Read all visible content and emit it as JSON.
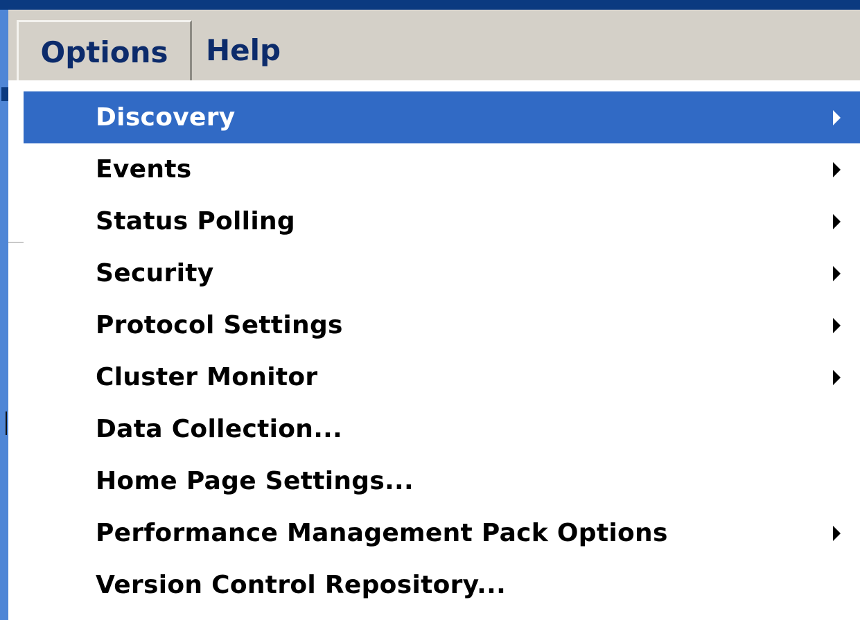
{
  "menubar": {
    "items": [
      {
        "label": "Options"
      },
      {
        "label": "Help"
      }
    ]
  },
  "dropdown": {
    "items": [
      {
        "label": "Discovery",
        "submenu": true,
        "highlighted": true
      },
      {
        "label": "Events",
        "submenu": true
      },
      {
        "label": "Status Polling",
        "submenu": true
      },
      {
        "label": "Security",
        "submenu": true
      },
      {
        "label": "Protocol Settings",
        "submenu": true
      },
      {
        "label": "Cluster Monitor",
        "submenu": true
      },
      {
        "label": "Data Collection...",
        "submenu": false
      },
      {
        "label": "Home Page Settings...",
        "submenu": false
      },
      {
        "label": "Performance Management Pack Options",
        "submenu": true
      },
      {
        "label": "Version Control Repository...",
        "submenu": false
      }
    ]
  },
  "colors": {
    "highlight": "#316ac5",
    "menubar_text": "#0c2b6b",
    "menubar_bg": "#d4d0c8"
  }
}
